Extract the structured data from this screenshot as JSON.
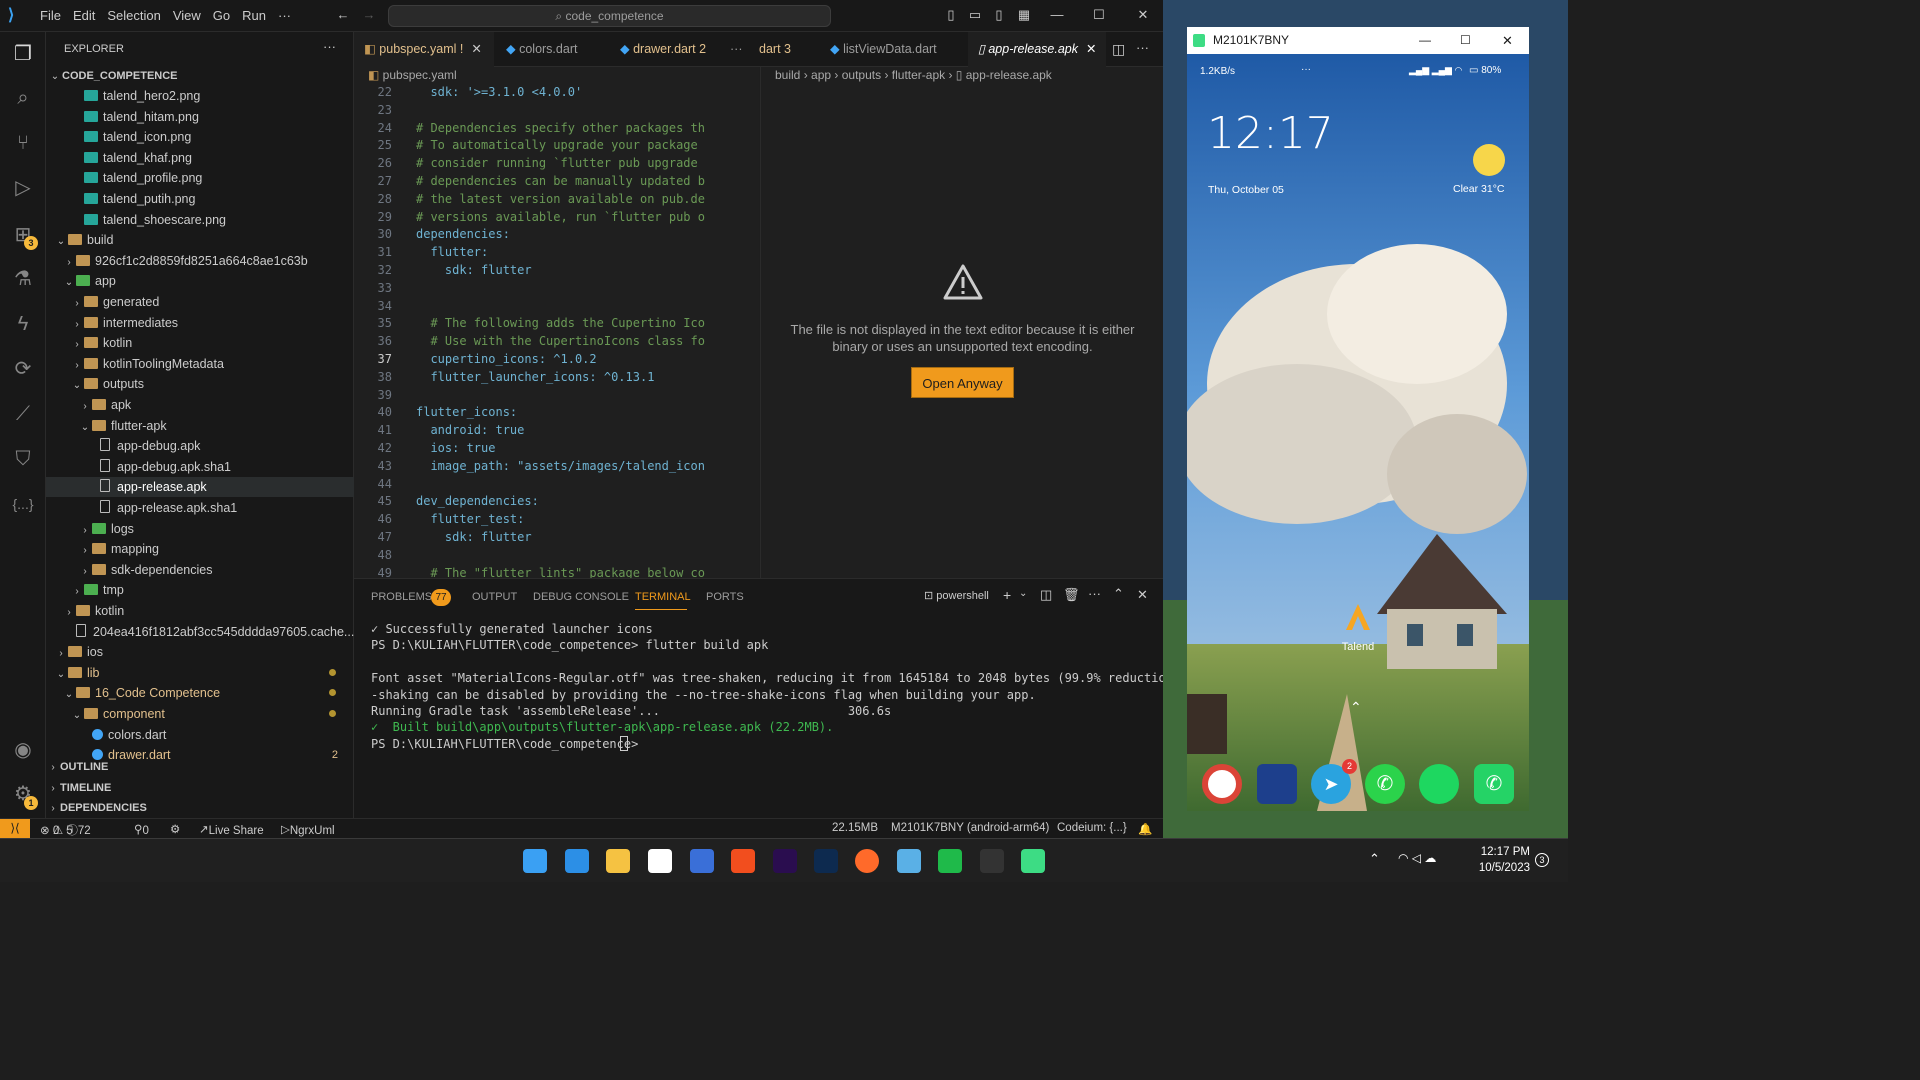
{
  "window": {
    "search": "code_competence",
    "menu": [
      "File",
      "Edit",
      "Selection",
      "View",
      "Go",
      "Run",
      "···"
    ]
  },
  "activity": {
    "run_badge": "3",
    "accounts_badge": "1"
  },
  "explorer": {
    "title": "EXPLORER",
    "root": "CODE_COMPETENCE",
    "items": [
      {
        "label": "talend_hero2.png",
        "type": "img"
      },
      {
        "label": "talend_hitam.png",
        "type": "img"
      },
      {
        "label": "talend_icon.png",
        "type": "img"
      },
      {
        "label": "talend_khaf.png",
        "type": "img"
      },
      {
        "label": "talend_profile.png",
        "type": "img"
      },
      {
        "label": "talend_putih.png",
        "type": "img"
      },
      {
        "label": "talend_shoescare.png",
        "type": "img"
      },
      {
        "label": "build",
        "type": "folder"
      },
      {
        "label": "926cf1c2d8859fd8251a664c8ae1c63b",
        "type": "folder"
      },
      {
        "label": "app",
        "type": "folder"
      },
      {
        "label": "generated",
        "type": "folder"
      },
      {
        "label": "intermediates",
        "type": "folder"
      },
      {
        "label": "kotlin",
        "type": "folder"
      },
      {
        "label": "kotlinToolingMetadata",
        "type": "folder"
      },
      {
        "label": "outputs",
        "type": "folder"
      },
      {
        "label": "apk",
        "type": "folder"
      },
      {
        "label": "flutter-apk",
        "type": "folder"
      },
      {
        "label": "app-debug.apk",
        "type": "file"
      },
      {
        "label": "app-debug.apk.sha1",
        "type": "file"
      },
      {
        "label": "app-release.apk",
        "type": "file"
      },
      {
        "label": "app-release.apk.sha1",
        "type": "file"
      },
      {
        "label": "logs",
        "type": "folder"
      },
      {
        "label": "mapping",
        "type": "folder"
      },
      {
        "label": "sdk-dependencies",
        "type": "folder"
      },
      {
        "label": "tmp",
        "type": "folder"
      },
      {
        "label": "kotlin",
        "type": "folder"
      },
      {
        "label": "204ea416f1812abf3cc545dddda97605.cache...",
        "type": "file"
      },
      {
        "label": "ios",
        "type": "folder"
      },
      {
        "label": "lib",
        "type": "folder"
      },
      {
        "label": "16_Code Competence",
        "type": "folder"
      },
      {
        "label": "component",
        "type": "folder"
      },
      {
        "label": "colors.dart",
        "type": "dart"
      },
      {
        "label": "drawer.dart",
        "type": "dart",
        "count": "2"
      }
    ],
    "sections": [
      "OUTLINE",
      "TIMELINE",
      "DEPENDENCIES"
    ]
  },
  "tabs": [
    {
      "label": "pubspec.yaml !"
    },
    {
      "label": "colors.dart"
    },
    {
      "label": "drawer.dart",
      "count": "2"
    },
    {
      "label": "···"
    },
    {
      "label": "dart",
      "count": "3"
    },
    {
      "label": "listViewData.dart"
    },
    {
      "label": "app-release.apk"
    }
  ],
  "editor": {
    "breadcrumb": "pubspec.yaml",
    "lines": [
      {
        "n": "22",
        "t": "  sdk: '>=3.1.0 <4.0.0'"
      },
      {
        "n": "23",
        "t": ""
      },
      {
        "n": "24",
        "t": "# Dependencies specify other packages th"
      },
      {
        "n": "25",
        "t": "# To automatically upgrade your package"
      },
      {
        "n": "26",
        "t": "# consider running `flutter pub upgrade"
      },
      {
        "n": "27",
        "t": "# dependencies can be manually updated b"
      },
      {
        "n": "28",
        "t": "# the latest version available on pub.de"
      },
      {
        "n": "29",
        "t": "# versions available, run `flutter pub o"
      },
      {
        "n": "30",
        "t": "dependencies:"
      },
      {
        "n": "31",
        "t": "  flutter:"
      },
      {
        "n": "32",
        "t": "    sdk: flutter"
      },
      {
        "n": "33",
        "t": ""
      },
      {
        "n": "34",
        "t": ""
      },
      {
        "n": "35",
        "t": "  # The following adds the Cupertino Ico"
      },
      {
        "n": "36",
        "t": "  # Use with the CupertinoIcons class fo"
      },
      {
        "n": "37",
        "t": "  cupertino_icons: ^1.0.2"
      },
      {
        "n": "38",
        "t": "  flutter_launcher_icons: ^0.13.1"
      },
      {
        "n": "39",
        "t": ""
      },
      {
        "n": "40",
        "t": "flutter_icons:"
      },
      {
        "n": "41",
        "t": "  android: true"
      },
      {
        "n": "42",
        "t": "  ios: true"
      },
      {
        "n": "43",
        "t": "  image_path: \"assets/images/talend_icon"
      },
      {
        "n": "44",
        "t": ""
      },
      {
        "n": "45",
        "t": "dev_dependencies:"
      },
      {
        "n": "46",
        "t": "  flutter_test:"
      },
      {
        "n": "47",
        "t": "    sdk: flutter"
      },
      {
        "n": "48",
        "t": ""
      },
      {
        "n": "49",
        "t": "  # The \"flutter_lints\" package below co"
      }
    ]
  },
  "preview": {
    "breadcrumb": [
      "build",
      "app",
      "outputs",
      "flutter-apk",
      "app-release.apk"
    ],
    "message_1": "The file is not displayed in the text editor because it is either",
    "message_2": "binary or uses an unsupported text encoding.",
    "button": "Open Anyway"
  },
  "panel": {
    "tabs": {
      "problems": "PROBLEMS",
      "problems_count": "77",
      "output": "OUTPUT",
      "debug": "DEBUG CONSOLE",
      "terminal": "TERMINAL",
      "ports": "PORTS"
    },
    "shell": "powershell",
    "lines": [
      "✓ Successfully generated launcher icons",
      "PS D:\\KULIAH\\FLUTTER\\code_competence> flutter build apk",
      "",
      "Font asset \"MaterialIcons-Regular.otf\" was tree-shaken, reducing it from 1645184 to 2048 bytes (99.9% reduction). Tree",
      "-shaking can be disabled by providing the --no-tree-shake-icons flag when building your app.",
      "Running Gradle task 'assembleRelease'...                          306.6s",
      "✓  Built build\\app\\outputs\\flutter-apk\\app-release.apk (22.2MB).",
      "PS D:\\KULIAH\\FLUTTER\\code_competence> "
    ]
  },
  "status": {
    "errors": "0",
    "warnings": "5",
    "infos": "72",
    "ports": "0",
    "live_share": "Live Share",
    "ngrx": "NgrxUml",
    "size": "22.15MB",
    "device": "M2101K7BNY (android-arm64)",
    "codeium": "Codeium: {...}"
  },
  "phone": {
    "window_title": "M2101K7BNY",
    "net": "1.2KB/s",
    "battery": "80%",
    "time": "12:17",
    "date": "Thu, October 05",
    "weather": "Clear  31°C",
    "app_label": "Talend",
    "telegram_badge": "2"
  },
  "taskbar": {
    "time": "12:17 PM",
    "date": "10/5/2023",
    "notif": "3"
  },
  "colors": {
    "accent": "#f09a1c",
    "folder": "#c09553",
    "terminal_active": "#f09a1c"
  }
}
